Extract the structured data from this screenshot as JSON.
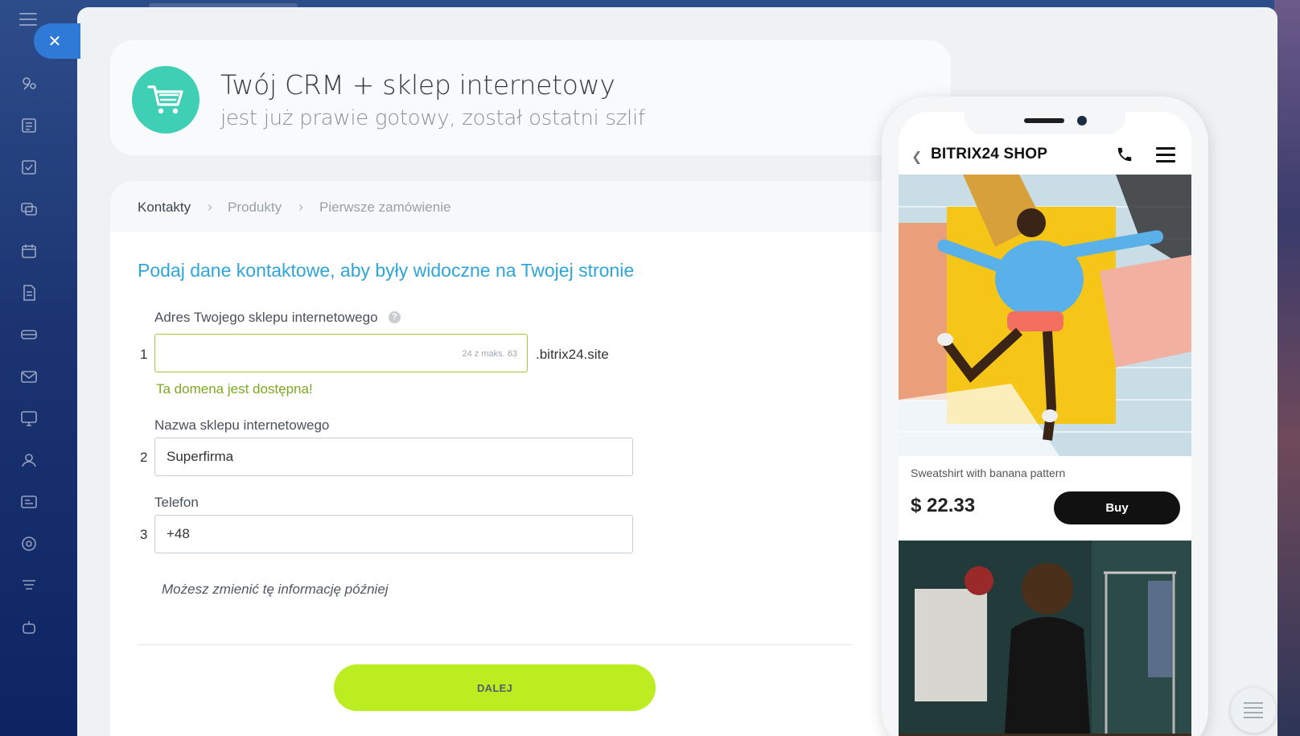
{
  "header": {
    "title": "Twój CRM + sklep internetowy",
    "subtitle": "jest już prawie gotowy, został ostatni szlif",
    "icon": "shopping-cart-icon",
    "icon_color": "#3fcfb5"
  },
  "steps": [
    "Kontakty",
    "Produkty",
    "Pierwsze zamówienie"
  ],
  "form": {
    "title": "Podaj dane kontaktowe, aby były widoczne na Twojej stronie",
    "fields": [
      {
        "number": "1",
        "label": "Adres Twojego sklepu internetowego",
        "value": "",
        "counter": "24 z maks. 63",
        "suffix": ".bitrix24.site",
        "status": "Ta domena jest dostępna!"
      },
      {
        "number": "2",
        "label": "Nazwa sklepu internetowego",
        "value": "Superfirma"
      },
      {
        "number": "3",
        "label": "Telefon",
        "value": "+48"
      }
    ],
    "note": "Możesz zmienić tę informację później",
    "next_label": "DALEJ",
    "next_color": "#bbed21",
    "title_color": "#2fa5d9",
    "status_color": "#7ea821"
  },
  "phone_preview": {
    "shop_title": "BITRIX24 SHOP",
    "product_name": "Sweatshirt with banana pattern",
    "price": "$ 22.33",
    "buy_label": "Buy"
  },
  "colors": {
    "accent": "#2f7ad6",
    "sidebar": "#1b3471"
  }
}
